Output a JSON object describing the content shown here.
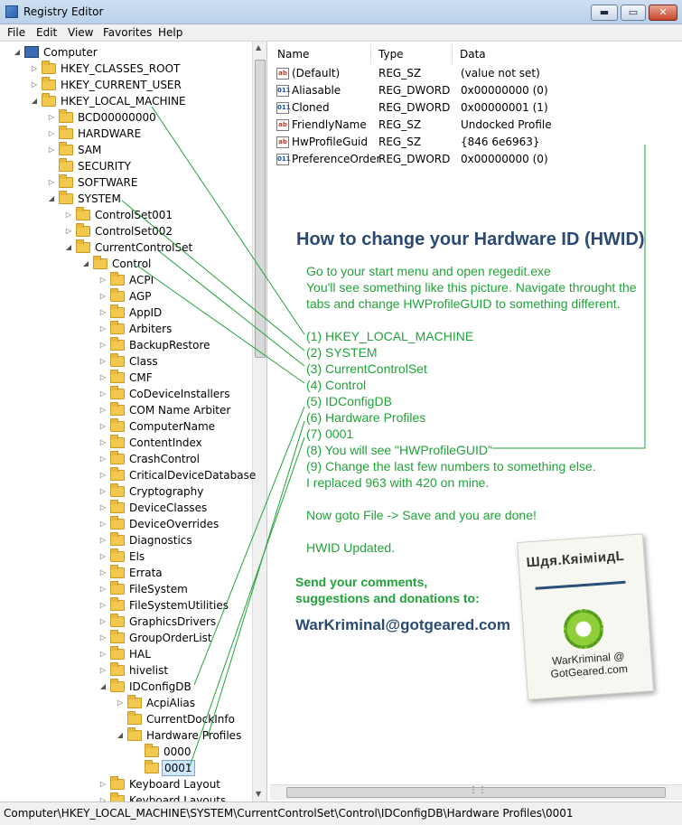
{
  "window": {
    "title": "Registry Editor"
  },
  "window_buttons": {
    "minimize": "▬",
    "maximize": "▭",
    "close": "✕"
  },
  "menu": [
    "File",
    "Edit",
    "View",
    "Favorites",
    "Help"
  ],
  "tree": {
    "root": "Computer",
    "hives": [
      "HKEY_CLASSES_ROOT",
      "HKEY_CURRENT_USER",
      "HKEY_LOCAL_MACHINE"
    ],
    "hklm_children": [
      "BCD00000000",
      "HARDWARE",
      "SAM",
      "SECURITY",
      "SOFTWARE",
      "SYSTEM"
    ],
    "system_children": [
      "ControlSet001",
      "ControlSet002",
      "CurrentControlSet"
    ],
    "ccs_children": [
      "Control"
    ],
    "control_children": [
      "ACPI",
      "AGP",
      "AppID",
      "Arbiters",
      "BackupRestore",
      "Class",
      "CMF",
      "CoDeviceInstallers",
      "COM Name Arbiter",
      "ComputerName",
      "ContentIndex",
      "CrashControl",
      "CriticalDeviceDatabase",
      "Cryptography",
      "DeviceClasses",
      "DeviceOverrides",
      "Diagnostics",
      "Els",
      "Errata",
      "FileSystem",
      "FileSystemUtilities",
      "GraphicsDrivers",
      "GroupOrderList",
      "HAL",
      "hivelist",
      "IDConfigDB"
    ],
    "idconfigdb_children": [
      "AcpiAlias",
      "CurrentDockInfo",
      "Hardware Profiles"
    ],
    "hwprofiles_children": [
      "0000",
      "0001"
    ],
    "after": [
      "Keyboard Layout",
      "Keyboard Layouts"
    ],
    "selected": "0001"
  },
  "values_table": {
    "headers": [
      "Name",
      "Type",
      "Data"
    ],
    "rows": [
      {
        "icon": "ab",
        "name": "(Default)",
        "type": "REG_SZ",
        "data": "(value not set)"
      },
      {
        "icon": "011",
        "name": "Aliasable",
        "type": "REG_DWORD",
        "data": "0x00000000 (0)"
      },
      {
        "icon": "011",
        "name": "Cloned",
        "type": "REG_DWORD",
        "data": "0x00000001 (1)"
      },
      {
        "icon": "ab",
        "name": "FriendlyName",
        "type": "REG_SZ",
        "data": "Undocked Profile"
      },
      {
        "icon": "ab",
        "name": "HwProfileGuid",
        "type": "REG_SZ",
        "data": "{846                                   6e6963}"
      },
      {
        "icon": "011",
        "name": "PreferenceOrder",
        "type": "REG_DWORD",
        "data": "0x00000000 (0)"
      }
    ]
  },
  "tutorial": {
    "heading": "How to change your Hardware ID (HWID)",
    "intro": [
      "Go to your start menu and open regedit.exe",
      "You'll see something like this picture.  Navigate throught the",
      "tabs and change HWProfileGUID to something different."
    ],
    "steps": [
      "(1) HKEY_LOCAL_MACHINE",
      "(2) SYSTEM",
      "(3) CurrentControlSet",
      "(4) Control",
      "(5) IDConfigDB",
      "(6) Hardware Profiles",
      "(7) 0001",
      "(8) You will see \"HWProfileGUID\"",
      "(9) Change the last few numbers to something else.",
      "     I replaced 963 with 420 on mine."
    ],
    "save": "Now goto File -> Save and you are done!",
    "updated": "HWID Updated.",
    "send": [
      "Send your comments,",
      "suggestions and donations to:"
    ],
    "email": "WarKriminal@gotgeared.com"
  },
  "logo": {
    "top": "Шдя.КяiмiидL",
    "name_line1": "WarKriminal @",
    "name_line2": "GotGeared.com"
  },
  "status": {
    "path": "Computer\\HKEY_LOCAL_MACHINE\\SYSTEM\\CurrentControlSet\\Control\\IDConfigDB\\Hardware Profiles\\0001"
  },
  "colors": {
    "tutorial_text": "#22a23a",
    "heading": "#2b4a72",
    "selection": "#cde8ff"
  }
}
